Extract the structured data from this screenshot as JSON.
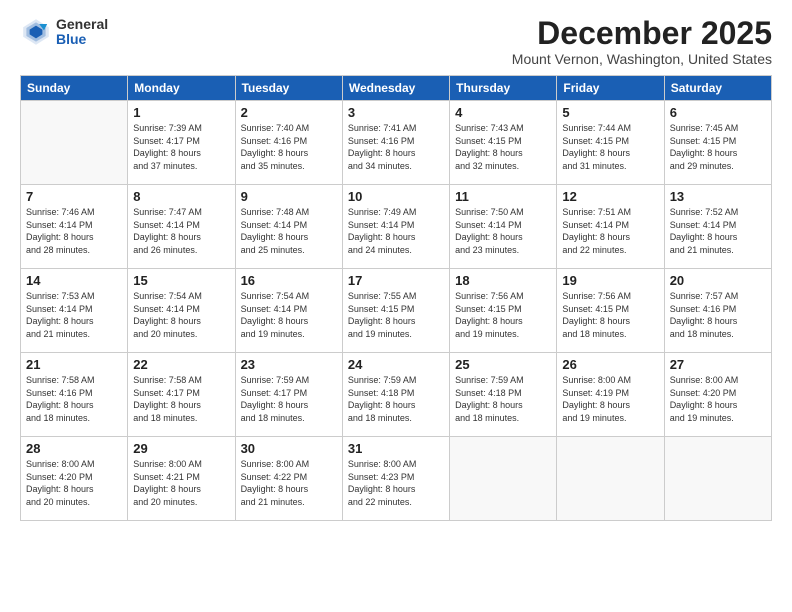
{
  "logo": {
    "general": "General",
    "blue": "Blue"
  },
  "header": {
    "month": "December 2025",
    "location": "Mount Vernon, Washington, United States"
  },
  "days_of_week": [
    "Sunday",
    "Monday",
    "Tuesday",
    "Wednesday",
    "Thursday",
    "Friday",
    "Saturday"
  ],
  "weeks": [
    [
      {
        "day": "",
        "content": ""
      },
      {
        "day": "1",
        "content": "Sunrise: 7:39 AM\nSunset: 4:17 PM\nDaylight: 8 hours\nand 37 minutes."
      },
      {
        "day": "2",
        "content": "Sunrise: 7:40 AM\nSunset: 4:16 PM\nDaylight: 8 hours\nand 35 minutes."
      },
      {
        "day": "3",
        "content": "Sunrise: 7:41 AM\nSunset: 4:16 PM\nDaylight: 8 hours\nand 34 minutes."
      },
      {
        "day": "4",
        "content": "Sunrise: 7:43 AM\nSunset: 4:15 PM\nDaylight: 8 hours\nand 32 minutes."
      },
      {
        "day": "5",
        "content": "Sunrise: 7:44 AM\nSunset: 4:15 PM\nDaylight: 8 hours\nand 31 minutes."
      },
      {
        "day": "6",
        "content": "Sunrise: 7:45 AM\nSunset: 4:15 PM\nDaylight: 8 hours\nand 29 minutes."
      }
    ],
    [
      {
        "day": "7",
        "content": "Sunrise: 7:46 AM\nSunset: 4:14 PM\nDaylight: 8 hours\nand 28 minutes."
      },
      {
        "day": "8",
        "content": "Sunrise: 7:47 AM\nSunset: 4:14 PM\nDaylight: 8 hours\nand 26 minutes."
      },
      {
        "day": "9",
        "content": "Sunrise: 7:48 AM\nSunset: 4:14 PM\nDaylight: 8 hours\nand 25 minutes."
      },
      {
        "day": "10",
        "content": "Sunrise: 7:49 AM\nSunset: 4:14 PM\nDaylight: 8 hours\nand 24 minutes."
      },
      {
        "day": "11",
        "content": "Sunrise: 7:50 AM\nSunset: 4:14 PM\nDaylight: 8 hours\nand 23 minutes."
      },
      {
        "day": "12",
        "content": "Sunrise: 7:51 AM\nSunset: 4:14 PM\nDaylight: 8 hours\nand 22 minutes."
      },
      {
        "day": "13",
        "content": "Sunrise: 7:52 AM\nSunset: 4:14 PM\nDaylight: 8 hours\nand 21 minutes."
      }
    ],
    [
      {
        "day": "14",
        "content": "Sunrise: 7:53 AM\nSunset: 4:14 PM\nDaylight: 8 hours\nand 21 minutes."
      },
      {
        "day": "15",
        "content": "Sunrise: 7:54 AM\nSunset: 4:14 PM\nDaylight: 8 hours\nand 20 minutes."
      },
      {
        "day": "16",
        "content": "Sunrise: 7:54 AM\nSunset: 4:14 PM\nDaylight: 8 hours\nand 19 minutes."
      },
      {
        "day": "17",
        "content": "Sunrise: 7:55 AM\nSunset: 4:15 PM\nDaylight: 8 hours\nand 19 minutes."
      },
      {
        "day": "18",
        "content": "Sunrise: 7:56 AM\nSunset: 4:15 PM\nDaylight: 8 hours\nand 19 minutes."
      },
      {
        "day": "19",
        "content": "Sunrise: 7:56 AM\nSunset: 4:15 PM\nDaylight: 8 hours\nand 18 minutes."
      },
      {
        "day": "20",
        "content": "Sunrise: 7:57 AM\nSunset: 4:16 PM\nDaylight: 8 hours\nand 18 minutes."
      }
    ],
    [
      {
        "day": "21",
        "content": "Sunrise: 7:58 AM\nSunset: 4:16 PM\nDaylight: 8 hours\nand 18 minutes."
      },
      {
        "day": "22",
        "content": "Sunrise: 7:58 AM\nSunset: 4:17 PM\nDaylight: 8 hours\nand 18 minutes."
      },
      {
        "day": "23",
        "content": "Sunrise: 7:59 AM\nSunset: 4:17 PM\nDaylight: 8 hours\nand 18 minutes."
      },
      {
        "day": "24",
        "content": "Sunrise: 7:59 AM\nSunset: 4:18 PM\nDaylight: 8 hours\nand 18 minutes."
      },
      {
        "day": "25",
        "content": "Sunrise: 7:59 AM\nSunset: 4:18 PM\nDaylight: 8 hours\nand 18 minutes."
      },
      {
        "day": "26",
        "content": "Sunrise: 8:00 AM\nSunset: 4:19 PM\nDaylight: 8 hours\nand 19 minutes."
      },
      {
        "day": "27",
        "content": "Sunrise: 8:00 AM\nSunset: 4:20 PM\nDaylight: 8 hours\nand 19 minutes."
      }
    ],
    [
      {
        "day": "28",
        "content": "Sunrise: 8:00 AM\nSunset: 4:20 PM\nDaylight: 8 hours\nand 20 minutes."
      },
      {
        "day": "29",
        "content": "Sunrise: 8:00 AM\nSunset: 4:21 PM\nDaylight: 8 hours\nand 20 minutes."
      },
      {
        "day": "30",
        "content": "Sunrise: 8:00 AM\nSunset: 4:22 PM\nDaylight: 8 hours\nand 21 minutes."
      },
      {
        "day": "31",
        "content": "Sunrise: 8:00 AM\nSunset: 4:23 PM\nDaylight: 8 hours\nand 22 minutes."
      },
      {
        "day": "",
        "content": ""
      },
      {
        "day": "",
        "content": ""
      },
      {
        "day": "",
        "content": ""
      }
    ]
  ]
}
